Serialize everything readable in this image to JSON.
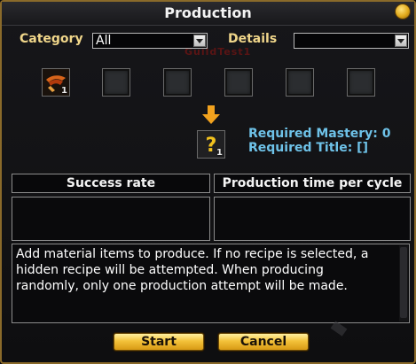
{
  "window": {
    "title": "Production",
    "ghost_text": "GuildTest1"
  },
  "filters": {
    "category_label": "Category",
    "category_value": "All",
    "details_label": "Details",
    "details_value": ""
  },
  "material_slots": [
    {
      "icon": "material-item-icon",
      "count": "1"
    },
    {
      "icon": "empty-slot",
      "count": ""
    },
    {
      "icon": "empty-slot",
      "count": ""
    },
    {
      "icon": "empty-slot",
      "count": ""
    },
    {
      "icon": "empty-slot",
      "count": ""
    },
    {
      "icon": "empty-slot",
      "count": ""
    }
  ],
  "result": {
    "icon": "question-mark-icon",
    "count": "1",
    "required_mastery": "Required Mastery: 0",
    "required_title": "Required Title: []"
  },
  "columns": {
    "success_rate_label": "Success rate",
    "production_time_label": "Production time per cycle",
    "success_rate_value": "",
    "production_time_value": ""
  },
  "description": "Add material items to produce. If no recipe is selected, a hidden recipe will be attempted. When producing randomly, only one production attempt will be made.",
  "buttons": {
    "start": "Start",
    "cancel": "Cancel"
  },
  "colors": {
    "frame_gold": "#8a6a2a",
    "label_gold": "#f0d68a",
    "info_blue": "#6ec2e8",
    "button_gold": "#f3c23a"
  }
}
